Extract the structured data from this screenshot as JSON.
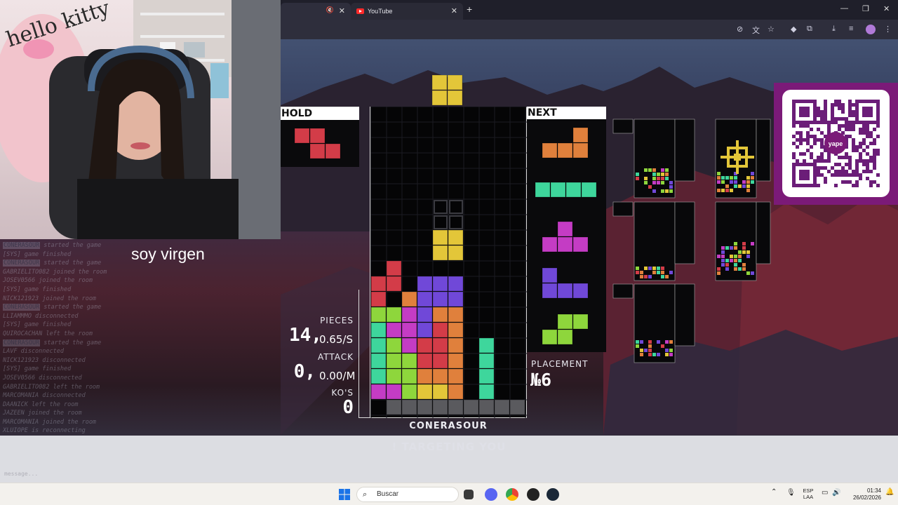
{
  "browser": {
    "tabs": [
      {
        "label": "",
        "icon": "mute-icon"
      },
      {
        "label": "YouTube",
        "icon": "youtube-icon"
      }
    ],
    "new_tab_icon": "plus-icon",
    "window_controls": [
      "minimize-icon",
      "restore-icon",
      "close-icon"
    ]
  },
  "stream": {
    "caption": "soy virgen",
    "chat_lines": [
      {
        "user": "CONERASOUR",
        "text": " started the game"
      },
      {
        "user": "",
        "text": "[SYS] game finished"
      },
      {
        "user": "CONERASOUR",
        "text": " started the game"
      },
      {
        "user": "",
        "text": "GABRIELITO082 joined the room"
      },
      {
        "user": "",
        "text": "JOSEV0566 joined the room"
      },
      {
        "user": "",
        "text": "[SYS] game finished"
      },
      {
        "user": "",
        "text": "NICK121923 joined the room"
      },
      {
        "user": "CONERASOUR",
        "text": " started the game"
      },
      {
        "user": "",
        "text": "LLIAMMMO disconnected"
      },
      {
        "user": "",
        "text": "[SYS] game finished"
      },
      {
        "user": "",
        "text": "QUIROCACHAN left the room"
      },
      {
        "user": "CONERASOUR",
        "text": " started the game"
      },
      {
        "user": "",
        "text": "LAVF disconnected"
      },
      {
        "user": "",
        "text": "NICK121923 disconnected"
      },
      {
        "user": "",
        "text": "[SYS] game finished"
      },
      {
        "user": "",
        "text": "JOSEV0566 disconnected"
      },
      {
        "user": "",
        "text": "GABRIELITO082 left the room"
      },
      {
        "user": "",
        "text": "MARCOMANIA disconnected"
      },
      {
        "user": "",
        "text": "DAANICK left the room"
      },
      {
        "user": "",
        "text": "JAZEEN joined the room"
      },
      {
        "user": "",
        "text": "MARCOMANIA joined the room"
      },
      {
        "user": "",
        "text": "XLUIOPE is reconnecting"
      }
    ],
    "chat_input_hint": "message..."
  },
  "game": {
    "hold_label": "HOLD",
    "next_label": "NEXT",
    "pieces_label": "PIECES",
    "pieces_value": "14,",
    "pieces_rate": "0.65/S",
    "attack_label": "ATTACK",
    "attack_value": "0,",
    "attack_rate": "0.00/M",
    "kos_label": "KO'S",
    "kos_value": "0",
    "placement_label": "PLACEMENT",
    "placement_value": "№6",
    "player_name": "CONERASOUR",
    "targeting_text": "! TARGETING YOU",
    "colors": {
      "Z": "#d33c48",
      "L": "#e0803c",
      "O": "#e3c639",
      "S": "#8ed63c",
      "I": "#3ed69c",
      "J": "#7048d8",
      "T": "#c43cc4",
      "G": "#5a5a5e"
    },
    "hold_piece": "Z",
    "next_pieces": [
      "L",
      "I",
      "T",
      "J",
      "S"
    ]
  },
  "qr": {
    "brand": "yape"
  },
  "taskbar": {
    "search_placeholder": "Buscar",
    "lang_top": "ESP",
    "lang_bottom": "LAA",
    "time": "01:34",
    "date": "26/02/2026"
  }
}
